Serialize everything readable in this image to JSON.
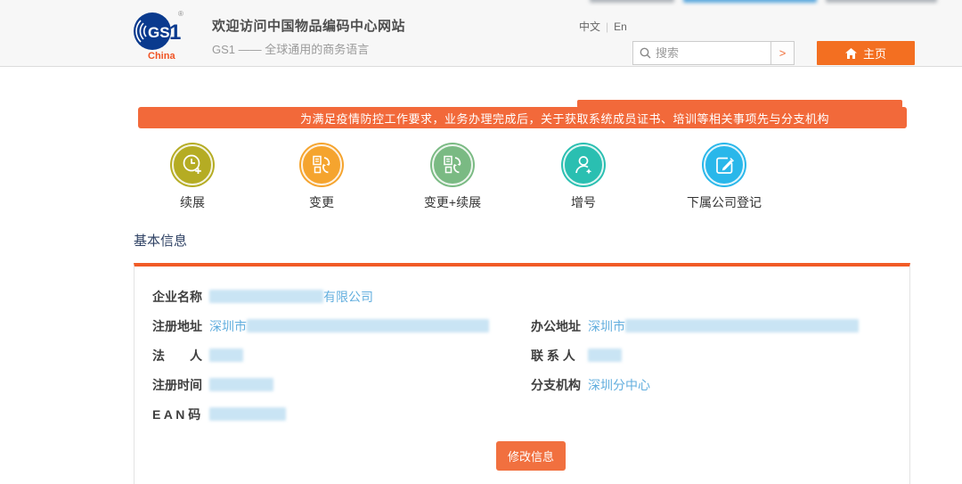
{
  "header": {
    "logo": {
      "brand": "GS1",
      "region": "China",
      "registered": "®"
    },
    "title": "欢迎访问中国物品编码中心网站",
    "subtitle": "GS1 —— 全球通用的商务语言",
    "lang": {
      "zh": "中文",
      "en": "En"
    },
    "search": {
      "placeholder": "搜索",
      "submit": ">"
    },
    "home_button": "主页"
  },
  "banner": {
    "text": "为满足疫情防控工作要求，业务办理完成后，关于获取系统成员证书、培训等相关事项先与分支机构",
    "color": "#f2693a"
  },
  "services": [
    {
      "label": "续展",
      "icon": "clock-plus-icon",
      "color": "#b5ac23"
    },
    {
      "label": "变更",
      "icon": "doc-refresh-icon",
      "color": "#f5a42e"
    },
    {
      "label": "变更+续展",
      "icon": "doc-refresh-icon",
      "color": "#7aba83"
    },
    {
      "label": "增号",
      "icon": "person-plus-icon",
      "color": "#2abfb1"
    },
    {
      "label": "下属公司登记",
      "icon": "edit-icon",
      "color": "#29b7ea"
    }
  ],
  "basic_info": {
    "section_title": "基本信息",
    "company_name": {
      "label": "企业名称",
      "visible_suffix": "有限公司"
    },
    "registered_address": {
      "label": "注册地址",
      "visible_prefix": "深圳市"
    },
    "office_address": {
      "label": "办公地址",
      "visible_prefix": "深圳市"
    },
    "legal_person": {
      "label": "法　　人"
    },
    "contact_person": {
      "label": "联 系 人"
    },
    "registration_time": {
      "label": "注册时间"
    },
    "branch": {
      "label": "分支机构",
      "value": "深圳分中心"
    },
    "ean_code": {
      "label": "E A N 码"
    },
    "modify_button": "修改信息"
  },
  "ui_colors": {
    "accent_orange": "#f36f21",
    "panel_border_orange": "#f15b26",
    "value_blue": "#62aede",
    "title_navy": "#2f4264",
    "logo_navy": "#0a3a8e",
    "logo_china_orange": "#f05323"
  }
}
